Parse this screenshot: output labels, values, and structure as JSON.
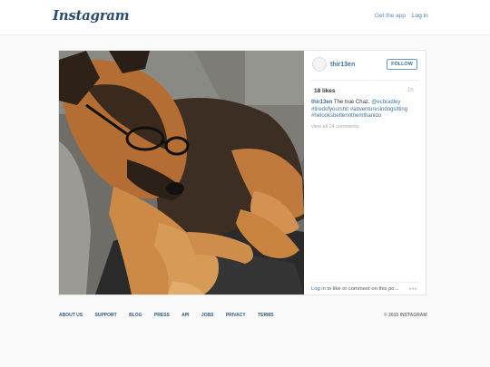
{
  "header": {
    "logo": "Instagram",
    "get_app": "Get the app",
    "login": "Log in"
  },
  "post": {
    "photo_icon": "dog-photo",
    "username": "thir13en",
    "follow": "FOLLOW",
    "likes": "18 likes",
    "time": "1h",
    "caption_user": "thir13en",
    "caption_text": " The true Chaz. ",
    "caption_mention": "@ecbradley",
    "caption_tags": "#tiredofyourshit #adventuresindogsitting #helooksbetterinthemthanido",
    "view_all": "view all 24 comments",
    "login_link": "Log in",
    "login_rest": " to like or comment on this po...",
    "more": "•••"
  },
  "footer": {
    "links": [
      "ABOUT US",
      "SUPPORT",
      "BLOG",
      "PRESS",
      "API",
      "JOBS",
      "PRIVACY",
      "TERMS"
    ],
    "copyright": "© 2015 INSTAGRAM"
  },
  "colors": {
    "link": "#3f729b",
    "logo": "#2a4d6e",
    "background": "#fafafa"
  }
}
